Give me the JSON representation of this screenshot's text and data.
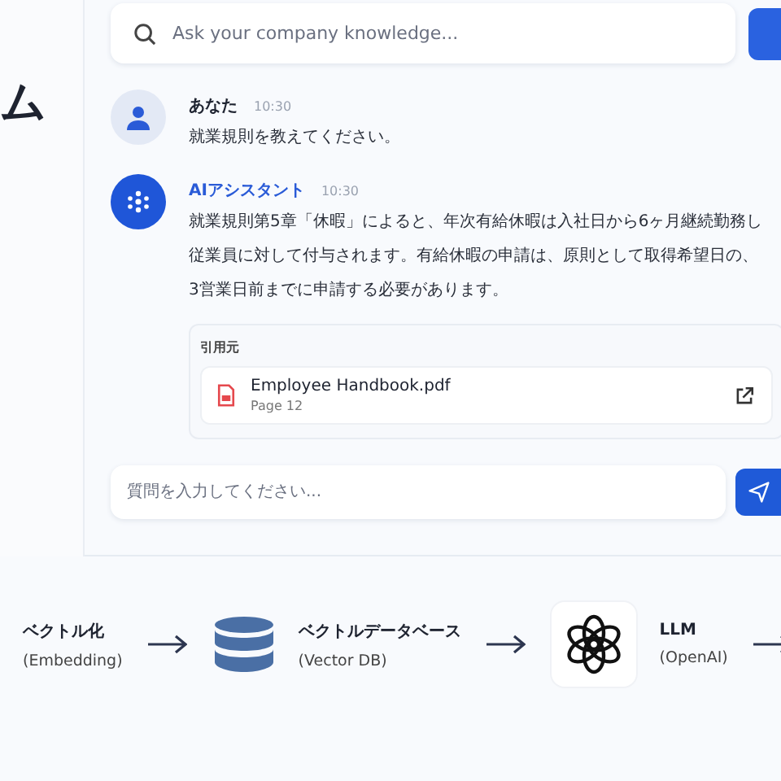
{
  "title_fragment": "ム",
  "search": {
    "placeholder": "Ask your company knowledge..."
  },
  "messages": [
    {
      "kind": "user",
      "sender": "あなた",
      "time": "10:30",
      "lines": [
        "就業規則を教えてください。"
      ]
    },
    {
      "kind": "assistant",
      "sender": "AIアシスタント",
      "time": "10:30",
      "lines": [
        "就業規則第5章「休暇」によると、年次有給休暇は入社日から6ヶ月継続勤務し",
        "従業員に対して付与されます。有給休暇の申請は、原則として取得希望日の、",
        "3営業日前までに申請する必要があります。"
      ],
      "citation": {
        "label": "引用元",
        "file": "Employee Handbook.pdf",
        "page": "Page 12"
      }
    }
  ],
  "composer": {
    "placeholder": "質問を入力してください..."
  },
  "pipeline": [
    {
      "kind": "text",
      "title": "ベクトル化",
      "subtitle": "(Embedding)"
    },
    {
      "kind": "database",
      "title": "ベクトルデータベース",
      "subtitle": "(Vector DB)"
    },
    {
      "kind": "llm",
      "title": "LLM",
      "subtitle": "(OpenAI)"
    }
  ]
}
